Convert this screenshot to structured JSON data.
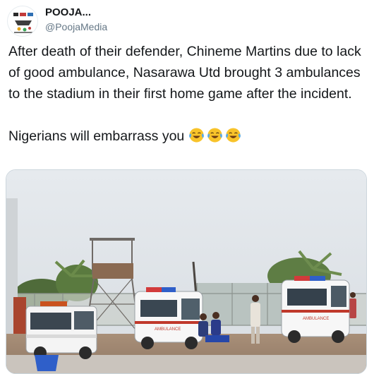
{
  "account": {
    "display_name": "POOJA...",
    "handle": "@PoojaMedia",
    "avatar_icon": "pooja-media-logo-icon"
  },
  "tweet": {
    "text_paragraph_1": "After death of their defender, Chineme Martins due to lack of good ambulance, Nasarawa Utd brought 3 ambulances to the stadium in their first home game after the incident.",
    "text_paragraph_2": "Nigerians will embarrass you",
    "emojis": [
      "face-with-tears-of-joy",
      "face-with-tears-of-joy",
      "face-with-tears-of-joy"
    ]
  },
  "media": {
    "description_icon": "photo",
    "ambulance_text": "AMBULANCE"
  },
  "colors": {
    "text": "#14171a",
    "muted": "#657786",
    "border": "#ccd6dd",
    "emoji_yellow": "#f8c32a",
    "emoji_tear": "#5aa9e6"
  }
}
